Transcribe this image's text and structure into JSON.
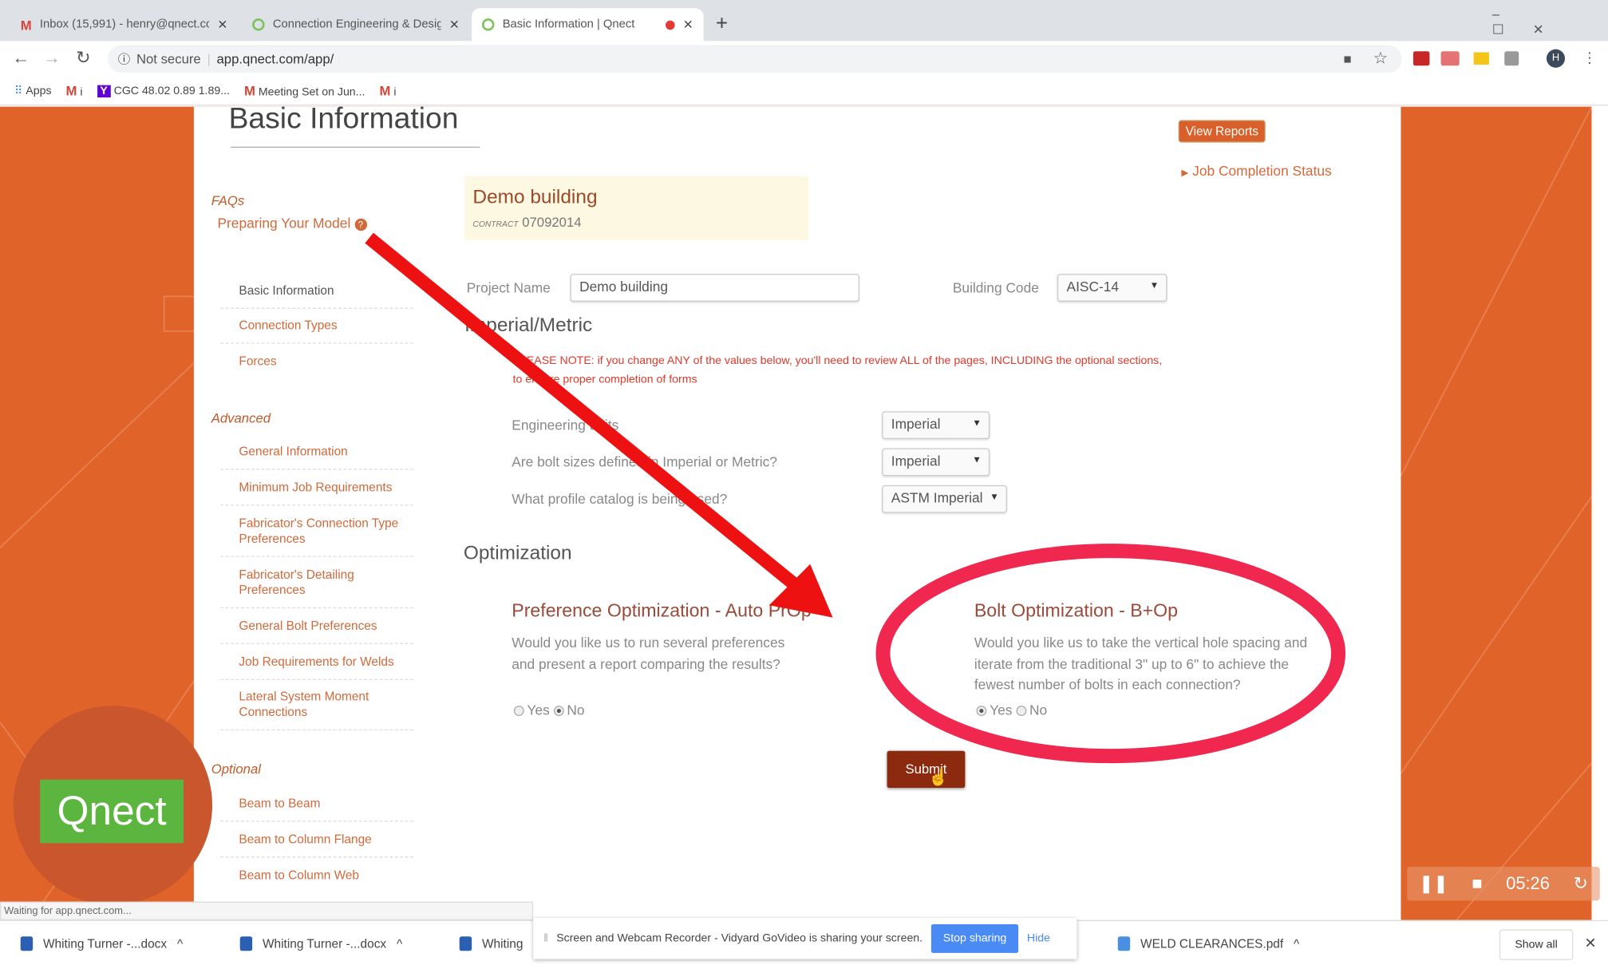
{
  "browser": {
    "tabs": [
      {
        "title": "Inbox (15,991) - henry@qnect.co",
        "icon": "gmail-icon"
      },
      {
        "title": "Connection Engineering & Desig",
        "icon": "qnect-icon"
      },
      {
        "title": "Basic Information | Qnect",
        "icon": "qnect-icon",
        "active": true,
        "recording": true
      }
    ],
    "security": "Not secure",
    "url": "app.qnect.com/app/",
    "bookmarks": [
      "Apps",
      "i",
      "CGC 48.02 0.89 1.89...",
      "Meeting Set on Jun...",
      "i"
    ],
    "avatar": "H",
    "status": "Waiting for app.qnect.com..."
  },
  "page": {
    "title": "Basic Information",
    "view_reports": "View Reports",
    "job_completion": "Job Completion Status",
    "faqs": "FAQs",
    "preparing_model": "Preparing Your Model",
    "sidebar": {
      "main": [
        "Basic Information",
        "Connection Types",
        "Forces"
      ],
      "advanced_label": "Advanced",
      "advanced": [
        "General Information",
        "Minimum Job Requirements",
        "Fabricator's Connection Type Preferences",
        "Fabricator's Detailing Preferences",
        "General Bolt Preferences",
        "Job Requirements for Welds",
        "Lateral System Moment Connections"
      ],
      "optional_label": "Optional",
      "optional": [
        "Beam to Beam",
        "Beam to Column Flange",
        "Beam to Column Web"
      ]
    },
    "project_card": {
      "name": "Demo building",
      "contract_label": "CONTRACT",
      "contract": "07092014"
    },
    "project_name_label": "Project Name",
    "project_name_value": "Demo building",
    "building_code_label": "Building Code",
    "building_code_value": "AISC-14",
    "imperial_metric": "Imperial/Metric",
    "note_line1": "PLEASE NOTE: if you change ANY of the values below, you'll need to review ALL of the pages, INCLUDING the optional sections,",
    "note_line2": "to ensure proper completion of forms",
    "fields": [
      {
        "label": "Engineering units",
        "value": "Imperial"
      },
      {
        "label": "Are bolt sizes defined in Imperial or Metric?",
        "value": "Imperial"
      },
      {
        "label": "What profile catalog is being used?",
        "value": "ASTM Imperial"
      }
    ],
    "optimization": "Optimization",
    "pref_opt": {
      "title": "Preference Optimization - Auto PrOp",
      "desc": "Would you like us to run several preferences and present a report comparing the results?",
      "yes": "Yes",
      "no": "No",
      "selected": "No"
    },
    "bolt_opt": {
      "title": "Bolt Optimization - B+Op",
      "desc": "Would you like us to take the vertical hole spacing and iterate from the traditional 3\" up to 6\" to achieve the fewest number of bolts in each connection?",
      "yes": "Yes",
      "no": "No",
      "selected": "Yes"
    },
    "submit": "Submit",
    "logo": "Qnect"
  },
  "recorder": {
    "time": "05:26"
  },
  "downloads": {
    "items": [
      "Whiting Turner -...docx",
      "Whiting Turner -...docx",
      "Whiting",
      "WELD CLEARANCES.pdf"
    ],
    "share_msg": "Screen and Webcam Recorder - Vidyard GoVideo is sharing your screen.",
    "stop_sharing": "Stop sharing",
    "hide": "Hide",
    "show_all": "Show all"
  },
  "colors": {
    "accent": "#e0642a",
    "submit": "#8b2a0f",
    "annotation_red": "#ee1111",
    "circle": "#f0284f",
    "logo_green": "#5cb53e"
  }
}
